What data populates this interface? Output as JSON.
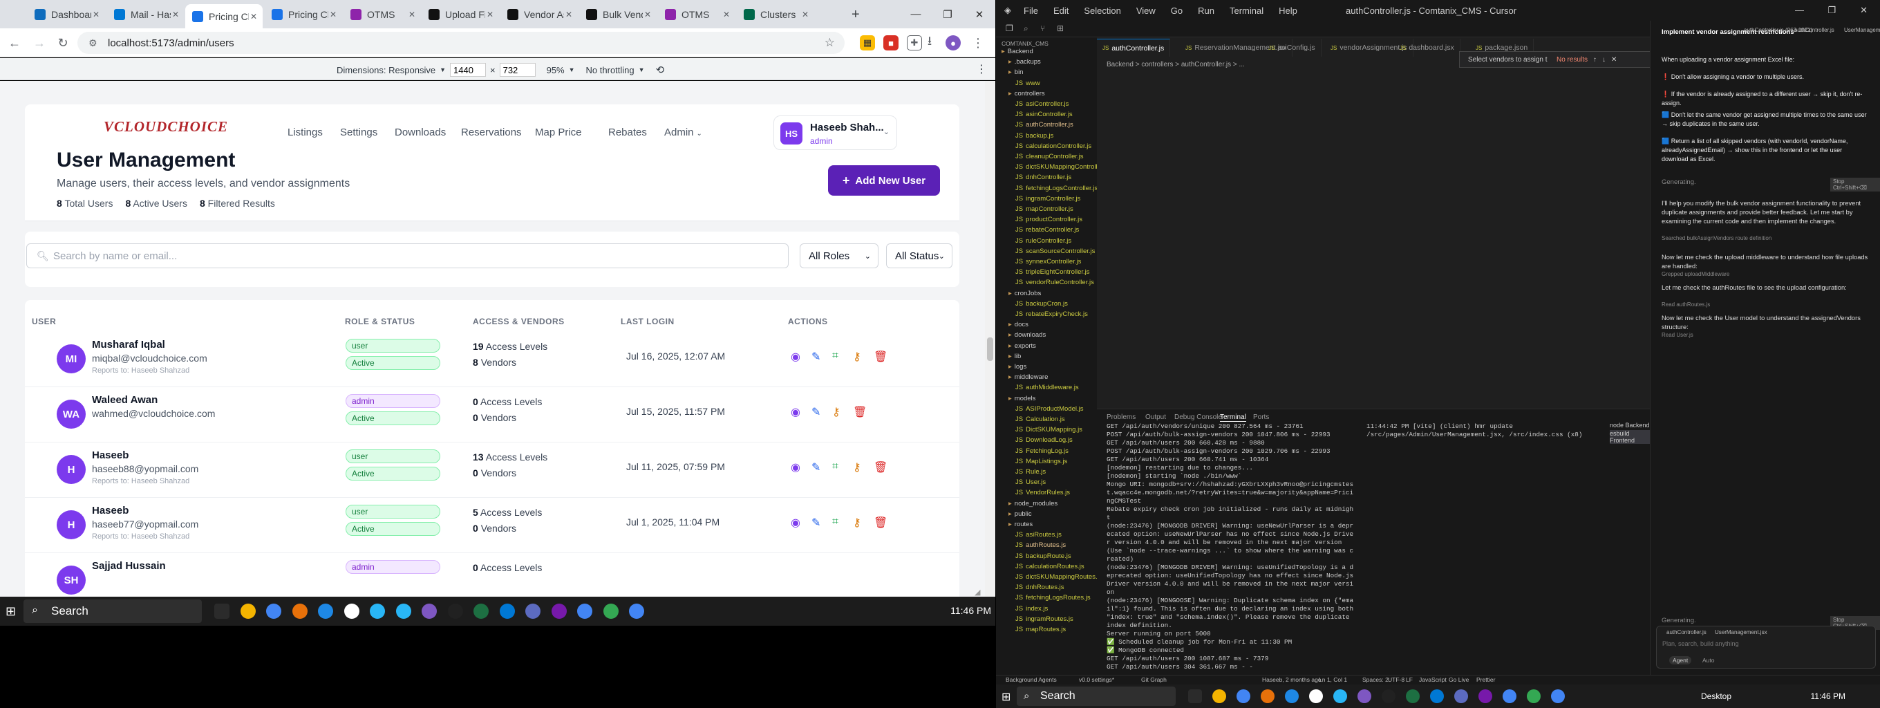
{
  "browser": {
    "tabs": [
      {
        "title": "Dashboard",
        "color": "#0f6cbd"
      },
      {
        "title": "Mail - Haseeb",
        "color": "#0078d4"
      },
      {
        "title": "Pricing Choice",
        "color": "#1a73e8"
      },
      {
        "title": "Pricing Choice",
        "color": "#1a73e8"
      },
      {
        "title": "OTMS",
        "color": "#8e24aa"
      },
      {
        "title": "Upload Files",
        "color": "#111111"
      },
      {
        "title": "Vendor Assign",
        "color": "#111111"
      },
      {
        "title": "Bulk Vendor",
        "color": "#111111"
      },
      {
        "title": "OTMS",
        "color": "#8e24aa"
      },
      {
        "title": "Clusters",
        "color": "#00684a"
      }
    ],
    "url": "localhost:5173/admin/users",
    "devtools": {
      "dimensions_label": "Dimensions: Responsive",
      "width": "1440",
      "height": "732",
      "zoom": "95%",
      "throttling": "No throttling"
    }
  },
  "site": {
    "logo": "VCLOUDCHOICE",
    "nav": [
      "Listings",
      "Settings",
      "Downloads",
      "Reservations",
      "Map Price",
      "Rebates",
      "Admin"
    ],
    "user": {
      "initials": "HS",
      "name": "Haseeb Shah...",
      "role": "admin"
    },
    "page_title": "User Management",
    "page_subtitle": "Manage users, their access levels, and vendor assignments",
    "stats": [
      {
        "count": "8",
        "label": "Total Users"
      },
      {
        "count": "8",
        "label": "Active Users"
      },
      {
        "count": "8",
        "label": "Filtered Results"
      }
    ],
    "add_button": "Add New User",
    "search_placeholder": "Search by name or email...",
    "role_filter": "All Roles",
    "status_filter": "All Status",
    "columns": [
      "USER",
      "ROLE & STATUS",
      "ACCESS & VENDORS",
      "LAST LOGIN",
      "ACTIONS"
    ],
    "users": [
      {
        "initials": "MI",
        "name": "Musharaf Iqbal",
        "email": "miqbal@vcloudchoice.com",
        "reports_to": "Reports to: Haseeb Shahzad",
        "role": "user",
        "status": "Active",
        "access_count": "19",
        "access_label": "Access Levels",
        "vendor_count": "8",
        "vendor_label": "Vendors",
        "last_login": "Jul 16, 2025, 12:07 AM"
      },
      {
        "initials": "WA",
        "name": "Waleed Awan",
        "email": "wahmed@vcloudchoice.com",
        "reports_to": "",
        "role": "admin",
        "status": "Active",
        "access_count": "0",
        "access_label": "Access Levels",
        "vendor_count": "0",
        "vendor_label": "Vendors",
        "last_login": "Jul 15, 2025, 11:57 PM"
      },
      {
        "initials": "H",
        "name": "Haseeb",
        "email": "haseeb88@yopmail.com",
        "reports_to": "Reports to: Haseeb Shahzad",
        "role": "user",
        "status": "Active",
        "access_count": "13",
        "access_label": "Access Levels",
        "vendor_count": "0",
        "vendor_label": "Vendors",
        "last_login": "Jul 11, 2025, 07:59 PM"
      },
      {
        "initials": "H",
        "name": "Haseeb",
        "email": "haseeb77@yopmail.com",
        "reports_to": "Reports to: Haseeb Shahzad",
        "role": "user",
        "status": "Active",
        "access_count": "5",
        "access_label": "Access Levels",
        "vendor_count": "0",
        "vendor_label": "Vendors",
        "last_login": "Jul 1, 2025, 11:04 PM"
      },
      {
        "initials": "SH",
        "name": "Sajjad Hussain",
        "email": "",
        "reports_to": "",
        "role": "admin",
        "status": "",
        "access_count": "0",
        "access_label": "Access Levels",
        "vendor_count": "",
        "vendor_label": "",
        "last_login": ""
      }
    ]
  },
  "taskbar": {
    "search": "Search",
    "time": "11:46 PM"
  },
  "editor": {
    "menu": [
      "File",
      "Edit",
      "Selection",
      "View",
      "Go",
      "Run",
      "Terminal",
      "Help"
    ],
    "title": "authController.js - Comtanix_CMS - Cursor",
    "explorer_title": "COMTANIX_CMS",
    "tree": [
      {
        "name": "Backend",
        "kind": "dir",
        "depth": 0
      },
      {
        "name": ".backups",
        "kind": "dir",
        "depth": 1
      },
      {
        "name": "bin",
        "kind": "dir",
        "depth": 1
      },
      {
        "name": "www",
        "kind": "file",
        "depth": 2
      },
      {
        "name": "controllers",
        "kind": "dir",
        "depth": 1
      },
      {
        "name": "asiController.js",
        "kind": "js",
        "depth": 2
      },
      {
        "name": "asinController.js",
        "kind": "js",
        "depth": 2
      },
      {
        "name": "authController.js",
        "kind": "mod",
        "depth": 2
      },
      {
        "name": "backup.js",
        "kind": "js",
        "depth": 2
      },
      {
        "name": "calculationController.js",
        "kind": "js",
        "depth": 2
      },
      {
        "name": "cleanupController.js",
        "kind": "js",
        "depth": 2
      },
      {
        "name": "dictSKUMappingController.js",
        "kind": "js",
        "depth": 2
      },
      {
        "name": "dnhController.js",
        "kind": "js",
        "depth": 2
      },
      {
        "name": "fetchingLogsController.js",
        "kind": "js",
        "depth": 2
      },
      {
        "name": "ingramController.js",
        "kind": "js",
        "depth": 2
      },
      {
        "name": "mapController.js",
        "kind": "js",
        "depth": 2
      },
      {
        "name": "productController.js",
        "kind": "js",
        "depth": 2
      },
      {
        "name": "rebateController.js",
        "kind": "js",
        "depth": 2
      },
      {
        "name": "ruleController.js",
        "kind": "js",
        "depth": 2
      },
      {
        "name": "scanSourceController.js",
        "kind": "js",
        "depth": 2
      },
      {
        "name": "synnexController.js",
        "kind": "js",
        "depth": 2
      },
      {
        "name": "tripleEightController.js",
        "kind": "js",
        "depth": 2
      },
      {
        "name": "vendorRuleController.js",
        "kind": "js",
        "depth": 2
      },
      {
        "name": "cronJobs",
        "kind": "dir",
        "depth": 1
      },
      {
        "name": "backupCron.js",
        "kind": "js",
        "depth": 2
      },
      {
        "name": "rebateExpiryCheck.js",
        "kind": "js",
        "depth": 2
      },
      {
        "name": "docs",
        "kind": "dir",
        "depth": 1
      },
      {
        "name": "downloads",
        "kind": "dir",
        "depth": 1
      },
      {
        "name": "exports",
        "kind": "dir",
        "depth": 1
      },
      {
        "name": "lib",
        "kind": "dir",
        "depth": 1
      },
      {
        "name": "logs",
        "kind": "dir",
        "depth": 1
      },
      {
        "name": "middleware",
        "kind": "dir",
        "depth": 1
      },
      {
        "name": "authMiddleware.js",
        "kind": "js",
        "depth": 2
      },
      {
        "name": "models",
        "kind": "dir",
        "depth": 1
      },
      {
        "name": "ASIProductModel.js",
        "kind": "js",
        "depth": 2
      },
      {
        "name": "Calculation.js",
        "kind": "js",
        "depth": 2
      },
      {
        "name": "DictSKUMapping.js",
        "kind": "js",
        "depth": 2
      },
      {
        "name": "DownloadLog.js",
        "kind": "js",
        "depth": 2
      },
      {
        "name": "FetchingLog.js",
        "kind": "js",
        "depth": 2
      },
      {
        "name": "MapListings.js",
        "kind": "js",
        "depth": 2
      },
      {
        "name": "Rule.js",
        "kind": "js",
        "depth": 2
      },
      {
        "name": "User.js",
        "kind": "js",
        "depth": 2
      },
      {
        "name": "VendorRules.js",
        "kind": "js",
        "depth": 2
      },
      {
        "name": "node_modules",
        "kind": "dir",
        "depth": 1
      },
      {
        "name": "public",
        "kind": "dir",
        "depth": 1
      },
      {
        "name": "routes",
        "kind": "dir",
        "depth": 1
      },
      {
        "name": "asiRoutes.js",
        "kind": "js",
        "depth": 2
      },
      {
        "name": "authRoutes.js",
        "kind": "mod",
        "depth": 2
      },
      {
        "name": "backupRoute.js",
        "kind": "js",
        "depth": 2
      },
      {
        "name": "calculationRoutes.js",
        "kind": "js",
        "depth": 2
      },
      {
        "name": "dictSKUMappingRoutes.js",
        "kind": "js",
        "depth": 2
      },
      {
        "name": "dnhRoutes.js",
        "kind": "js",
        "depth": 2
      },
      {
        "name": "fetchingLogsRoutes.js",
        "kind": "js",
        "depth": 2
      },
      {
        "name": "index.js",
        "kind": "js",
        "depth": 2
      },
      {
        "name": "ingramRoutes.js",
        "kind": "js",
        "depth": 2
      },
      {
        "name": "mapRoutes.js",
        "kind": "js",
        "depth": 2
      }
    ],
    "tabs": [
      "authController.js",
      "ReservationManagement.jsx",
      "asiConfig.js",
      "vendorAssignment.js",
      "dashboard.jsx",
      "package.json"
    ],
    "breadcrumb": "Backend > controllers > authController.js > ...",
    "find": "Select vendors to assign t",
    "find_result": "No results",
    "panel_tabs": [
      "Problems",
      "Output",
      "Debug Console",
      "Terminal",
      "Ports"
    ],
    "terminal_log": "GET /api/auth/vendors/unique 200 827.564 ms - 23761\nPOST /api/auth/bulk-assign-vendors 200 1047.806 ms - 22993\nGET /api/auth/users 200 660.428 ms - 9880\nPOST /api/auth/bulk-assign-vendors 200 1029.706 ms - 22993\nGET /api/auth/users 200 660.741 ms - 10364\n[nodemon] restarting due to changes...\n[nodemon] starting `node ./bin/www`\nMongo URI: mongodb+srv://hshahzad:yGXbrLXXph3vRnoo@pricingcmstest.wqacc4e.mongodb.net/?retryWrites=true&w=majority&appName=PricingCMSTest\nRebate expiry check cron job initialized - runs daily at midnight\n(node:23476) [MONGODB DRIVER] Warning: useNewUrlParser is a deprecated option: useNewUrlParser has no effect since Node.js Driver version 4.0.0 and will be removed in the next major version\n(Use `node --trace-warnings ...` to show where the warning was created)\n(node:23476) [MONGODB DRIVER] Warning: useUnifiedTopology is a deprecated option: useUnifiedTopology has no effect since Node.js Driver version 4.0.0 and will be removed in the next major version\n(node:23476) [MONGOOSE] Warning: Duplicate schema index on {\"email\":1} found. This is often due to declaring an index using both \"index: true\" and \"schema.index()\". Please remove the duplicate index definition.\nServer running on port 5000\n✅ Scheduled cleanup job for Mon-Fri at 11:30 PM\n✅ MongoDB connected\nGET /api/auth/users 200 1087.687 ms - 7379\nGET /api/auth/users 304 361.667 ms - -",
    "terminal_right": "11:44:42 PM [vite] (client) hmr update /src/pages/Admin/UserManagement.jsx, /src/index.css (x8)",
    "terminal_list": [
      "node Backend",
      "esbuild Frontend"
    ],
    "chat_title": "Implement vendor assignment restrictions",
    "chat_context": [
      "authController.js (963-1021)",
      "authController.js",
      "UserManagement.jsx"
    ],
    "chat_lines": [
      "When uploading a vendor assignment Excel file:",
      "❗ Don't allow assigning a vendor to multiple users.",
      "❗ If the vendor is already assigned to a different user → skip it, don't re-assign.",
      "🟦 Don't let the same vendor get assigned multiple times to the same user → skip duplicates in the same user.",
      "🟦 Return a list of all skipped vendors (with vendorId, vendorName, alreadyAssignedEmail) → show this in the frontend or let the user download as Excel."
    ],
    "generating": "Generating.",
    "stop": "Stop Ctrl+Shift+⌫",
    "assistant": [
      "I'll help you modify the bulk vendor assignment functionality to prevent duplicate assignments and provide better feedback. Let me start by examining the current code and then implement the changes.",
      "Searched bulkAssignVendors route definition",
      "Now let me check the upload middleware to understand how file uploads are handled:",
      "Grepped uploadMiddleware",
      "Let me check the authRoutes file to see the upload configuration:",
      "Read authRoutes.js",
      "Now let me check the User model to understand the assignedVendors structure:",
      "Read User.js"
    ],
    "input_placeholder": "Plan, search, build anything",
    "agent_label": "Agent",
    "auto_label": "Auto",
    "status_left": [
      "Background Agents",
      "v0.0 settings*",
      "Git Graph"
    ],
    "status_right": [
      "Haseeb, 2 months ago",
      "Ln 1, Col 1",
      "Spaces: 2",
      "UTF-8",
      "LF",
      "JavaScript",
      "Go Live",
      "Prettier"
    ]
  },
  "rtaskbar": {
    "search": "Search",
    "desktop": "Desktop",
    "time": "11:46 PM"
  }
}
